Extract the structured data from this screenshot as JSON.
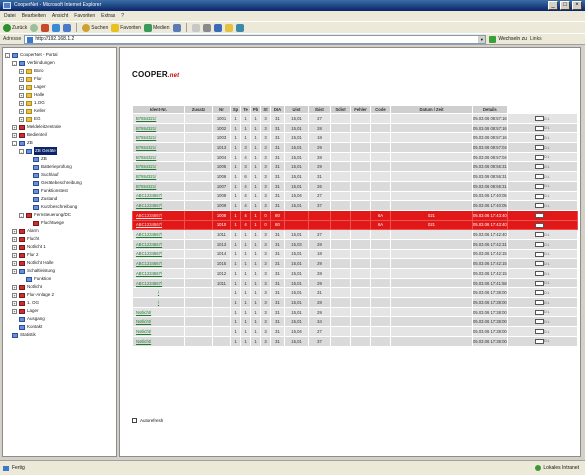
{
  "window": {
    "title": "CooperNet - Microsoft Internet Explorer"
  },
  "menubar": [
    "Datei",
    "Bearbeiten",
    "Ansicht",
    "Favoriten",
    "Extras",
    "?"
  ],
  "toolbar": {
    "back": "Zurück",
    "search": "Suchen",
    "favorites": "Favoriten",
    "media": "Medien"
  },
  "address": {
    "label": "Adresse",
    "url": "http://192.168.1.2",
    "go": "Wechseln zu",
    "links": "Links"
  },
  "tree": [
    {
      "label": "CooperNet - Portal",
      "icon": "comp",
      "indent": 0,
      "exp": "-"
    },
    {
      "label": "Verbindungen",
      "icon": "comp",
      "indent": 1,
      "exp": "-"
    },
    {
      "label": "Büro",
      "icon": "folder",
      "indent": 2,
      "exp": "+"
    },
    {
      "label": "Flur",
      "icon": "folder",
      "indent": 2,
      "exp": "+"
    },
    {
      "label": "Lager",
      "icon": "folder",
      "indent": 2,
      "exp": "+"
    },
    {
      "label": "Halle",
      "icon": "folder",
      "indent": 2,
      "exp": "+"
    },
    {
      "label": "1.OG",
      "icon": "folder",
      "indent": 2,
      "exp": "+"
    },
    {
      "label": "Keller",
      "icon": "folder",
      "indent": 2,
      "exp": "+"
    },
    {
      "label": "EG",
      "icon": "folder",
      "indent": 2,
      "exp": "+"
    },
    {
      "label": "Meldeleitzentrale",
      "icon": "red",
      "indent": 1,
      "exp": "+"
    },
    {
      "label": "Bedienteil",
      "icon": "red",
      "indent": 1,
      "exp": "+"
    },
    {
      "label": "ZB",
      "icon": "comp",
      "indent": 1,
      "exp": "-"
    },
    {
      "label": "ZB Geräte",
      "icon": "comp",
      "indent": 2,
      "exp": "-",
      "selected": true
    },
    {
      "label": "ZB",
      "icon": "comp",
      "indent": 3,
      "exp": ""
    },
    {
      "label": "Batterieprüfung",
      "icon": "comp",
      "indent": 3,
      "exp": ""
    },
    {
      "label": "Suchlauf",
      "icon": "comp",
      "indent": 3,
      "exp": ""
    },
    {
      "label": "Gerätebeschreibung",
      "icon": "comp",
      "indent": 3,
      "exp": ""
    },
    {
      "label": "Funktionstest",
      "icon": "comp",
      "indent": 3,
      "exp": ""
    },
    {
      "label": "Zustand",
      "icon": "comp",
      "indent": 3,
      "exp": ""
    },
    {
      "label": "Kurzbeschreibung",
      "icon": "comp",
      "indent": 3,
      "exp": ""
    },
    {
      "label": "Fernsteuerung/DC",
      "icon": "red",
      "indent": 2,
      "exp": "-"
    },
    {
      "label": "Fluchtwege",
      "icon": "red",
      "indent": 3,
      "exp": ""
    },
    {
      "label": "Alarm",
      "icon": "red",
      "indent": 1,
      "exp": "+"
    },
    {
      "label": "Flucht",
      "icon": "red",
      "indent": 1,
      "exp": "+"
    },
    {
      "label": "Notlicht 1",
      "icon": "red",
      "indent": 1,
      "exp": "+"
    },
    {
      "label": "Flur 2",
      "icon": "red",
      "indent": 1,
      "exp": "+"
    },
    {
      "label": "Notlicht Halle",
      "icon": "red",
      "indent": 1,
      "exp": "+"
    },
    {
      "label": "Schaltleistung",
      "icon": "comp",
      "indent": 1,
      "exp": "+"
    },
    {
      "label": "Funktion",
      "icon": "comp",
      "indent": 2,
      "exp": ""
    },
    {
      "label": "Notlicht",
      "icon": "red",
      "indent": 1,
      "exp": "+"
    },
    {
      "label": "Flur-Anlage 2",
      "icon": "red",
      "indent": 1,
      "exp": "+"
    },
    {
      "label": "1. OG",
      "icon": "red",
      "indent": 1,
      "exp": "+"
    },
    {
      "label": "Lager",
      "icon": "red",
      "indent": 1,
      "exp": "+"
    },
    {
      "label": "Ausgang",
      "icon": "comp",
      "indent": 1,
      "exp": ""
    },
    {
      "label": "Kontakt",
      "icon": "comp",
      "indent": 1,
      "exp": ""
    },
    {
      "label": "Statistik",
      "icon": "comp",
      "indent": 0,
      "exp": ""
    }
  ],
  "logo": {
    "text": "COOPER",
    "suffix": ".net"
  },
  "table": {
    "headers": [
      "Ident-Nr.",
      "Zusatz",
      "Nr",
      "Sp",
      "Te",
      "Pb",
      "St",
      "DIA",
      "Uist",
      "Ibist",
      "Sdist",
      "Fehler",
      "Code",
      "Datum / Zeit",
      "Details"
    ],
    "detail_text": "D L",
    "rows": [
      {
        "id": "B7654321/",
        "vals": [
          "",
          "1001",
          "1",
          "1",
          "1",
          "3",
          "31",
          "15,01",
          "27",
          "",
          "",
          "",
          "",
          "05.03.06 08:57:16"
        ],
        "link": true,
        "err": false
      },
      {
        "id": "B7654321/",
        "vals": [
          "",
          "1002",
          "1",
          "1",
          "1",
          "3",
          "31",
          "15,01",
          "28",
          "",
          "",
          "",
          "",
          "05.03.06 08:57:16"
        ],
        "link": true,
        "err": false
      },
      {
        "id": "B7654321/",
        "vals": [
          "",
          "1003",
          "1",
          "1",
          "1",
          "3",
          "31",
          "15,01",
          "18",
          "",
          "",
          "",
          "",
          "05.03.06 08:57:16"
        ],
        "link": true,
        "err": false
      },
      {
        "id": "B7654321/",
        "vals": [
          "",
          "1013",
          "1",
          "3",
          "1",
          "3",
          "31",
          "15,01",
          "29",
          "",
          "",
          "",
          "",
          "05.03.06 08:57:04"
        ],
        "link": true,
        "err": false
      },
      {
        "id": "B7654321/",
        "vals": [
          "",
          "1004",
          "1",
          "4",
          "1",
          "3",
          "31",
          "15,01",
          "28",
          "",
          "",
          "",
          "",
          "05.03.06 08:57:04"
        ],
        "link": true,
        "err": false
      },
      {
        "id": "B7654321/",
        "vals": [
          "",
          "1005",
          "1",
          "3",
          "1",
          "3",
          "31",
          "15,01",
          "29",
          "",
          "",
          "",
          "",
          "05.03.06 08:56:31"
        ],
        "link": true,
        "err": false
      },
      {
        "id": "B7654321/",
        "vals": [
          "",
          "1006",
          "1",
          "6",
          "1",
          "3",
          "31",
          "15,01",
          "31",
          "",
          "",
          "",
          "",
          "05.03.06 08:56:31"
        ],
        "link": true,
        "err": false
      },
      {
        "id": "B7654321/",
        "vals": [
          "",
          "1007",
          "1",
          "4",
          "1",
          "3",
          "31",
          "15,01",
          "26",
          "",
          "",
          "",
          "",
          "05.03.06 08:56:31"
        ],
        "link": true,
        "err": false
      },
      {
        "id": "ABC1234567/",
        "vals": [
          "",
          "1008",
          "1",
          "4",
          "1",
          "3",
          "31",
          "15,04",
          "27",
          "",
          "",
          "",
          "",
          "05.03.06 17:40:05"
        ],
        "link": true,
        "err": false
      },
      {
        "id": "ABC1234567/",
        "vals": [
          "",
          "1009",
          "1",
          "4",
          "1",
          "3",
          "31",
          "15,01",
          "37",
          "",
          "",
          "",
          "",
          "05.03.06 17:40:05"
        ],
        "link": true,
        "err": false
      },
      {
        "id": "ABC1234567/",
        "vals": [
          "",
          "1008",
          "1",
          "4",
          "1",
          "0",
          "80",
          "",
          "",
          "",
          "",
          "6A",
          "021",
          "05.03.06 17:43:40"
        ],
        "link": true,
        "err": true
      },
      {
        "id": "ABC1234567/",
        "vals": [
          "",
          "1010",
          "1",
          "4",
          "1",
          "0",
          "80",
          "",
          "",
          "",
          "",
          "6A",
          "021",
          "05.03.06 17:43:40"
        ],
        "link": true,
        "err": true
      },
      {
        "id": "ABC1234567/",
        "vals": [
          "",
          "1011",
          "1",
          "1",
          "1",
          "3",
          "31",
          "15,01",
          "27",
          "",
          "",
          "",
          "",
          "05.03.06 17:42:40"
        ],
        "link": true,
        "err": false
      },
      {
        "id": "ABC1234567/",
        "vals": [
          "",
          "1013",
          "1",
          "1",
          "1",
          "3",
          "31",
          "15,03",
          "28",
          "",
          "",
          "",
          "",
          "05.03.06 17:42:31"
        ],
        "link": true,
        "err": false
      },
      {
        "id": "ABC1234567/",
        "vals": [
          "",
          "1014",
          "1",
          "1",
          "1",
          "3",
          "31",
          "15,01",
          "18",
          "",
          "",
          "",
          "",
          "05.03.06 17:42:15"
        ],
        "link": true,
        "err": false
      },
      {
        "id": "ABC1234567/",
        "vals": [
          "",
          "1015",
          "1",
          "1",
          "1",
          "3",
          "31",
          "15,01",
          "29",
          "",
          "",
          "",
          "",
          "05.03.06 17:42:15"
        ],
        "link": true,
        "err": false
      },
      {
        "id": "ABC1234567/",
        "vals": [
          "",
          "1012",
          "1",
          "1",
          "1",
          "3",
          "31",
          "15,01",
          "28",
          "",
          "",
          "",
          "",
          "05.03.06 17:42:15"
        ],
        "link": true,
        "err": false
      },
      {
        "id": "ABC1234567/",
        "vals": [
          "",
          "1011",
          "1",
          "1",
          "1",
          "3",
          "31",
          "15,01",
          "29",
          "",
          "",
          "",
          "",
          "05.03.06 17:41:58"
        ],
        "link": true,
        "err": false
      },
      {
        "id": "/",
        "vals": [
          "",
          "",
          "1",
          "1",
          "1",
          "3",
          "31",
          "15,01",
          "31",
          "",
          "",
          "",
          "",
          "05.03.06 17:38:00"
        ],
        "link": true,
        "err": false,
        "center": true
      },
      {
        "id": "/",
        "vals": [
          "",
          "",
          "1",
          "1",
          "1",
          "3",
          "31",
          "15,01",
          "28",
          "",
          "",
          "",
          "",
          "05.03.06 17:38:00"
        ],
        "link": true,
        "err": false,
        "center": true
      },
      {
        "id": "Notlicht/",
        "vals": [
          "",
          "",
          "1",
          "1",
          "1",
          "3",
          "31",
          "15,01",
          "29",
          "",
          "",
          "",
          "",
          "05.03.06 17:38:00"
        ],
        "link": true,
        "err": false
      },
      {
        "id": "Notlicht/",
        "vals": [
          "",
          "",
          "1",
          "1",
          "1",
          "3",
          "31",
          "15,01",
          "34",
          "",
          "",
          "",
          "",
          "05.03.06 17:38:00"
        ],
        "link": true,
        "err": false
      },
      {
        "id": "Notlicht/",
        "vals": [
          "",
          "",
          "1",
          "1",
          "1",
          "3",
          "31",
          "15,04",
          "27",
          "",
          "",
          "",
          "",
          "05.03.06 17:38:00"
        ],
        "link": true,
        "err": false
      },
      {
        "id": "Notlicht/",
        "vals": [
          "",
          "",
          "1",
          "1",
          "1",
          "3",
          "31",
          "15,01",
          "37",
          "",
          "",
          "",
          "",
          "05.03.06 17:38:00"
        ],
        "link": true,
        "err": false
      }
    ]
  },
  "checkbox": {
    "label": "Autorefresh"
  },
  "status": {
    "left": "Fertig",
    "right": "Lokales Intranet"
  }
}
